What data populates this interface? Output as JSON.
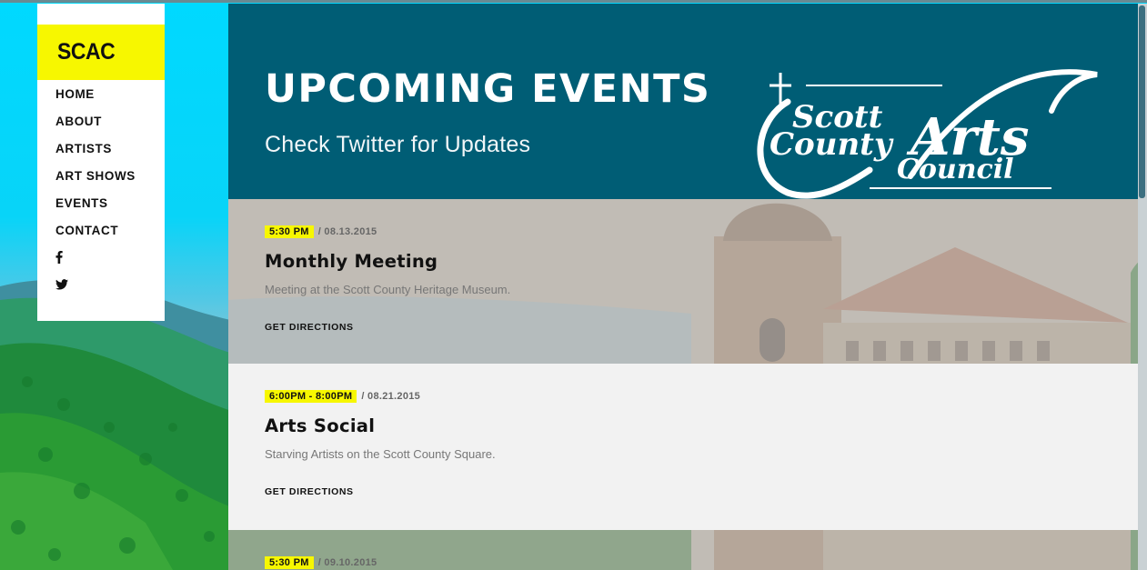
{
  "sidebar": {
    "brand": "SCAC",
    "nav": [
      {
        "label": "HOME"
      },
      {
        "label": "ABOUT"
      },
      {
        "label": "ARTISTS"
      },
      {
        "label": "ART SHOWS"
      },
      {
        "label": "EVENTS"
      },
      {
        "label": "CONTACT"
      }
    ],
    "social": [
      {
        "icon": "facebook-icon"
      },
      {
        "icon": "twitter-icon"
      }
    ]
  },
  "hero": {
    "title": "UPCOMING EVENTS",
    "subtitle": "Check Twitter for Updates",
    "logo_text": {
      "line1": "Scott",
      "line2": "County",
      "line3": "Arts",
      "line4": "Council"
    }
  },
  "events": [
    {
      "time": "5:30 PM",
      "date": "/ 08.13.2015",
      "title": "Monthly Meeting",
      "description": "Meeting at the Scott County Heritage Museum.",
      "link": "GET DIRECTIONS"
    },
    {
      "time": "6:00PM - 8:00PM",
      "date": "/ 08.21.2015",
      "title": "Arts Social",
      "description": "Starving Artists on the Scott County Square.",
      "link": "GET DIRECTIONS"
    },
    {
      "time": "5:30 PM",
      "date": "/ 09.10.2015"
    }
  ],
  "colors": {
    "accent_yellow": "#f7f700",
    "hero_teal": "#005d75",
    "sky": "#00d7ff"
  }
}
